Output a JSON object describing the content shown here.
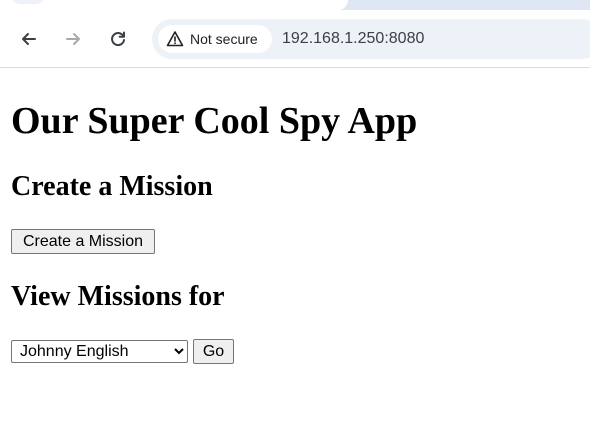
{
  "browser": {
    "security_label": "Not secure",
    "url": "192.168.1.250:8080",
    "icons": {
      "back": "back-arrow-icon",
      "forward": "forward-arrow-icon",
      "reload": "reload-icon",
      "warning": "warning-triangle-icon"
    }
  },
  "page": {
    "title": "Our Super Cool Spy App",
    "create_section": {
      "heading": "Create a Mission",
      "button_label": "Create a Mission"
    },
    "view_section": {
      "heading": "View Missions for",
      "selected_agent": "Johnny English",
      "go_label": "Go"
    }
  }
}
